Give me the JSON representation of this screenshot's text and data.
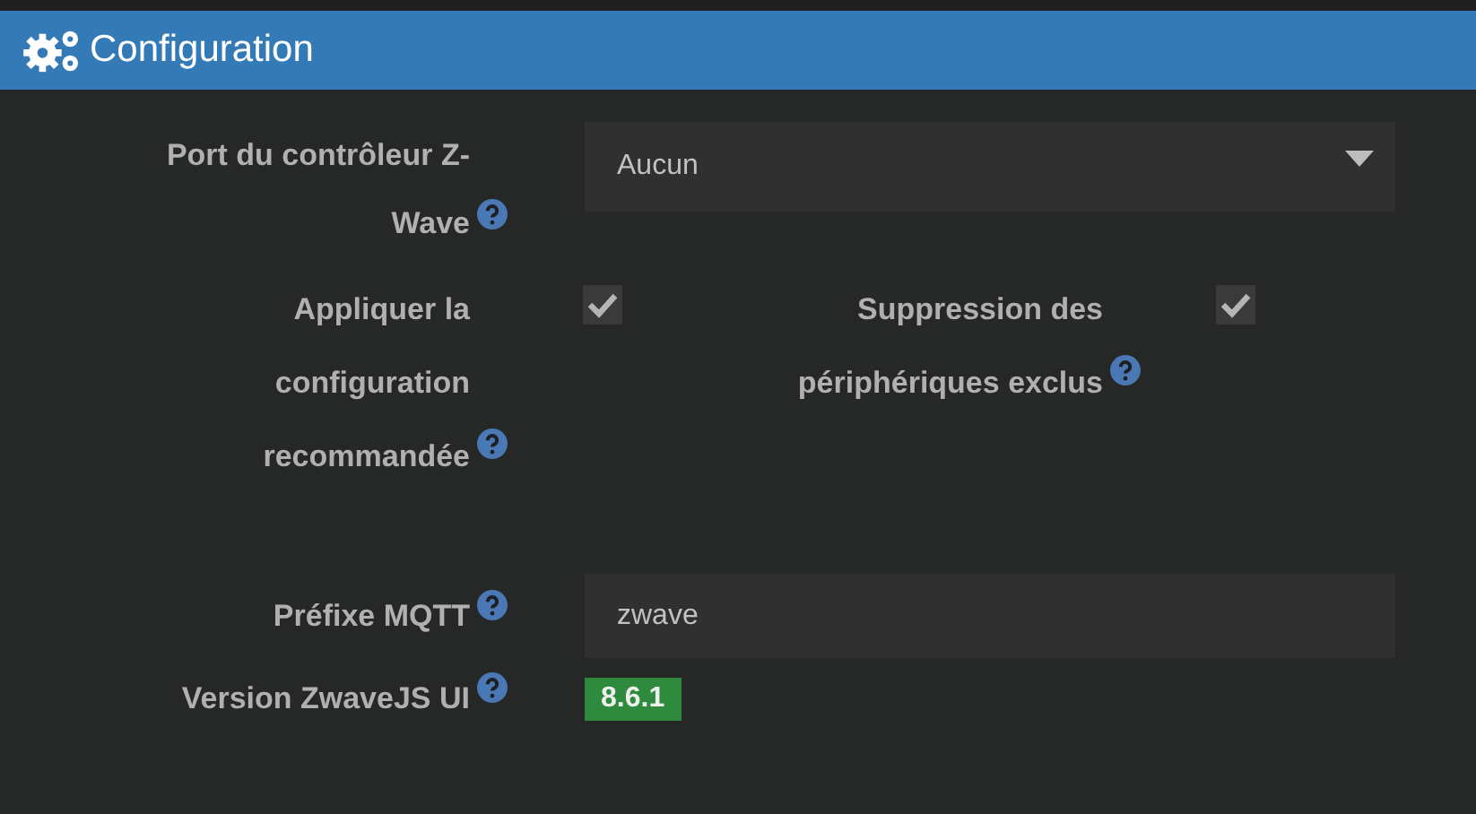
{
  "header": {
    "title": "Configuration"
  },
  "rows": [
    {
      "kind": "select",
      "label": "Port du contrôleur Z-Wave",
      "help": true,
      "value": "Aucun"
    },
    {
      "kind": "checkboxes",
      "items": [
        {
          "label": "Appliquer la configuration recommandée",
          "help": true,
          "checked": true
        },
        {
          "label": "Suppression des périphériques exclus",
          "help": true,
          "checked": true
        }
      ]
    },
    {
      "kind": "text",
      "label": "Préfixe MQTT",
      "help": true,
      "value": "zwave"
    },
    {
      "kind": "badge",
      "label": "Version ZwaveJS UI",
      "help": true,
      "value": "8.6.1"
    }
  ]
}
